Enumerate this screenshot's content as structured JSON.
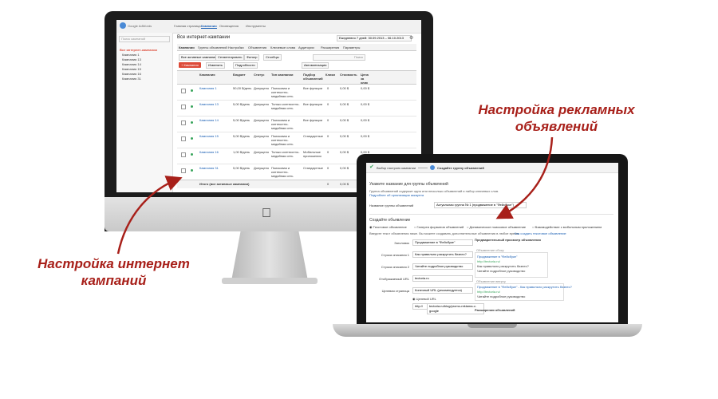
{
  "colors": {
    "accent": "#a8201a",
    "link": "#1a5fb4",
    "red_button": "#dd4b39",
    "green_check": "#3aa55d"
  },
  "callouts": {
    "ads": [
      "Настройка рекламных",
      "объявлений"
    ],
    "campaign": [
      "Настройка интернет",
      "кампаний"
    ]
  },
  "adwords": {
    "logo": "Google AdWords",
    "nav": [
      "Главная страница",
      "Кампании",
      "Оповещения",
      "Инструменты"
    ],
    "search_placeholder": "Поиск кампаний",
    "tree_root": "Все интернет-кампании",
    "tree": [
      "Кампания 1",
      "Кампания 13",
      "Кампания 14",
      "Кампания 15",
      "Кампания 16",
      "Кампания 31"
    ],
    "page_title": "Все интернет-кампании",
    "date_range": "Ежедневно 7 дней: 30.09.2013 – 06.10.2013",
    "tabs": [
      "Кампании",
      "Группы объявлений",
      "Настройки",
      "Объявления",
      "Ключевые слова",
      "Аудитории",
      "Расширения",
      "Параметры"
    ],
    "filters": [
      "Все активные кампании",
      "Сегментировать",
      "Фильтр",
      "Столбцы",
      "Поиск"
    ],
    "actions": {
      "campaign_button": "+ Кампания",
      "change": "Изменить",
      "details": "Подробности",
      "automation": "Автоматизация"
    },
    "columns": [
      "Кампания",
      "Бюджет",
      "Статус",
      "Тип кампании",
      "Подбор объявлений",
      "Клики",
      "Стоимость",
      "Цена за клик"
    ],
    "rows": [
      {
        "name": "Кампания 1",
        "budget": "50,00 $/день",
        "status": "Допущено",
        "type": "Поисковая и контекстно-медийная сеть",
        "ads": "Все функции",
        "clicks": "0",
        "cost": "0,00 $",
        "cpc": "0,00 $"
      },
      {
        "name": "Кампания 13",
        "budget": "5,00 $/день",
        "status": "Допущено",
        "type": "Только контекстно-медийная сеть",
        "ads": "Все функции",
        "clicks": "0",
        "cost": "0,00 $",
        "cpc": "0,00 $"
      },
      {
        "name": "Кампания 14",
        "budget": "5,00 $/день",
        "status": "Допущено",
        "type": "Поисковая и контекстно-медийная сеть",
        "ads": "Все функции",
        "clicks": "0",
        "cost": "0,00 $",
        "cpc": "0,00 $"
      },
      {
        "name": "Кампания 15",
        "budget": "5,00 $/день",
        "status": "Допущено",
        "type": "Поисковая и контекстно-медийная сеть",
        "ads": "Стандартные",
        "clicks": "0",
        "cost": "0,00 $",
        "cpc": "0,00 $"
      },
      {
        "name": "Кампания 16",
        "budget": "1,00 $/день",
        "status": "Допущено",
        "type": "Только контекстно-медийная сеть",
        "ads": "Мобильные приложения",
        "clicks": "0",
        "cost": "0,00 $",
        "cpc": "0,00 $"
      },
      {
        "name": "Кампания 31",
        "budget": "5,00 $/день",
        "status": "Допущено",
        "type": "Поисковая и контекстно-медийная сеть",
        "ads": "Стандартные",
        "clicks": "0",
        "cost": "0,00 $",
        "cpc": "0,00 $"
      }
    ],
    "total_label": "Итого (все активные кампании)",
    "total_clicks": "0",
    "total_cost": "0,00 $"
  },
  "adgroup": {
    "steps": [
      "Выбор настроек кампании",
      "Создайте группу объявлений"
    ],
    "section_title": "Укажите название для группы объявлений",
    "intro": "Группа объявлений содержит одно или несколько объявлений и набор ключевых слов.",
    "intro_link": "Подробнее об организации аккаунта",
    "name_label": "Название группы объявлений",
    "name_value": "Актуальная группа № 1 (продвижение в \"Фейсбуке\")",
    "create_title": "Создайте объявление",
    "ad_types": [
      "Текстовое объявление",
      "Галерея форматов объявлений",
      "Динамическое поисковое объявление",
      "Взаимодействие с мобильным приложением"
    ],
    "hint": "Введите текст объявления ниже. Вы можете создавать дополнительные объявления в любое время.",
    "hint_link": "Как создать текстовое объявление",
    "fields": [
      {
        "label": "Заголовок",
        "value": "Продвижение в \"Фейсбуке\""
      },
      {
        "label": "Строка описания 1",
        "value": "Как правильно раскрутить бизнес?"
      },
      {
        "label": "Строка описания 2",
        "value": "Читайте подробное руководство"
      },
      {
        "label": "Отображаемый URL",
        "value": "tectoria.ru"
      },
      {
        "label": "Целевая страница",
        "value": "Конечный URL (рекомендуется)"
      }
    ],
    "url_option": "Целевой URL",
    "url_prefix": "http://",
    "url_value": "tectoria.ru/blog/promo-reklama-v-google",
    "preview_title": "Предварительный просмотр объявления",
    "preview_sub": "Объявление сбоку",
    "preview_ad": {
      "headline": "Продвижение в \"Фейсбуке\"",
      "url": "http://tectoria.ru/",
      "line1": "Как правильно раскрутить бизнес?",
      "line2": "Читайте подробное руководство"
    },
    "preview_top": "Объявление вверху",
    "preview_top_headline": "Продвижение в \"Фейсбуке\" - Как правильно раскрутить бизнес?",
    "preview_top_url": "http://tectoria.ru/",
    "preview_top_line": "Читайте подробное руководство",
    "extensions": "Расширения объявлений"
  }
}
